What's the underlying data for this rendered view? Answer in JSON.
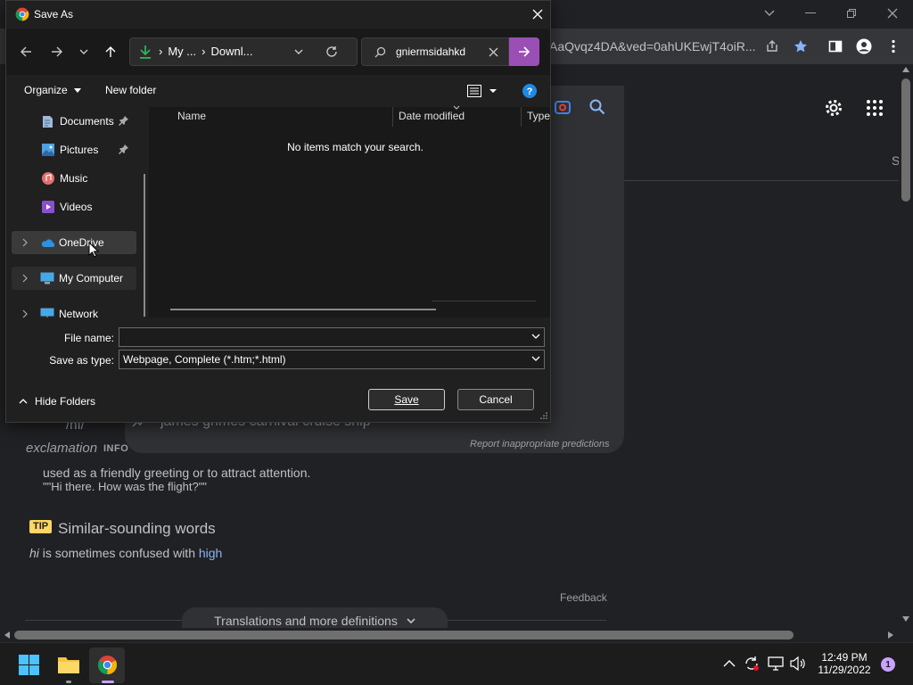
{
  "browser": {
    "url_tail": "AaQvqz4DA&ved=0ahUKEwjT4oiR..."
  },
  "page": {
    "suggestion": "james grimes carnival cruise ship",
    "report_link": "Report inappropriate predictions",
    "edge_letter": "S",
    "phonetic": "/hī/",
    "part_of_speech": "exclamation",
    "pos_tag": "INFO",
    "definition": "used as a friendly greeting or to attract attention.",
    "example": "\"\"Hi there. How was the flight?\"\"",
    "tip_badge": "TIP",
    "similar_heading": "Similar-sounding words",
    "similar_word": "hi",
    "similar_middle": " is sometimes confused with ",
    "similar_link": "high",
    "feedback": "Feedback",
    "translations": "Translations and more definitions"
  },
  "dialog": {
    "title": "Save As",
    "breadcrumbs": [
      "My ...",
      "Downl..."
    ],
    "search_value": "gniermsidahkd",
    "organize": "Organize",
    "new_folder": "New folder",
    "nav": [
      {
        "label": "Documents",
        "pinned": true
      },
      {
        "label": "Pictures",
        "pinned": true
      },
      {
        "label": "Music",
        "pinned": false
      },
      {
        "label": "Videos",
        "pinned": false
      },
      {
        "label": "OneDrive",
        "pinned": false
      },
      {
        "label": "My Computer",
        "pinned": false
      },
      {
        "label": "Network",
        "pinned": false
      }
    ],
    "columns": [
      "Name",
      "Date modified",
      "Type"
    ],
    "empty_message": "No items match your search.",
    "file_name_label": "File name:",
    "file_name_value": "",
    "save_type_label": "Save as type:",
    "save_type_value": "Webpage, Complete (*.htm;*.html)",
    "hide_folders": "Hide Folders",
    "save": "Save",
    "cancel": "Cancel"
  },
  "taskbar": {
    "time": "12:49 PM",
    "date": "11/29/2022",
    "notification_count": "1"
  },
  "colors": {
    "accent": "#9a4fb4",
    "link": "#8ab4f8",
    "tip": "#fdd663"
  }
}
